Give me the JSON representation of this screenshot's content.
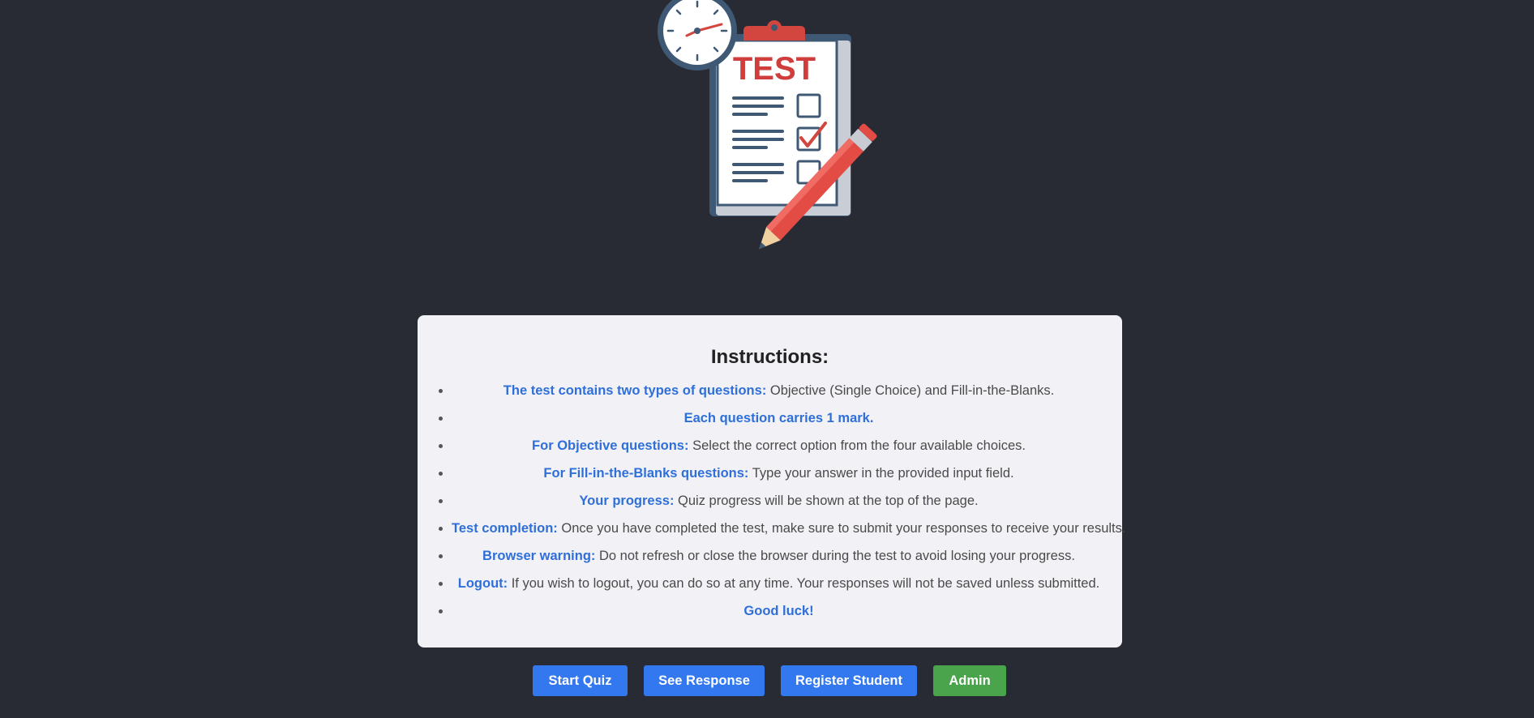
{
  "hero": {
    "badge_text": "TEST",
    "icon": "test-clipboard-icon"
  },
  "instructions": {
    "title": "Instructions:",
    "items": [
      {
        "label": "The test contains two types of questions:",
        "text": " Objective (Single Choice) and Fill-in-the-Blanks."
      },
      {
        "label": "Each question carries 1 mark.",
        "text": ""
      },
      {
        "label": "For Objective questions:",
        "text": " Select the correct option from the four available choices."
      },
      {
        "label": "For Fill-in-the-Blanks questions:",
        "text": " Type your answer in the provided input field."
      },
      {
        "label": "Your progress:",
        "text": " Quiz progress will be shown at the top of the page."
      },
      {
        "label": "Test completion:",
        "text": " Once you have completed the test, make sure to submit your responses to receive your results."
      },
      {
        "label": "Browser warning:",
        "text": " Do not refresh or close the browser during the test to avoid losing your progress."
      },
      {
        "label": "Logout:",
        "text": " If you wish to logout, you can do so at any time. Your responses will not be saved unless submitted."
      },
      {
        "label": "Good luck!",
        "text": ""
      }
    ]
  },
  "buttons": {
    "start_quiz": "Start Quiz",
    "see_response": "See Response",
    "register_student": "Register Student",
    "admin": "Admin"
  },
  "colors": {
    "background": "#282b34",
    "card": "#f2f2f6",
    "highlight": "#2e6fd9",
    "primary_button": "#3478f0",
    "admin_button": "#4aa44c"
  }
}
